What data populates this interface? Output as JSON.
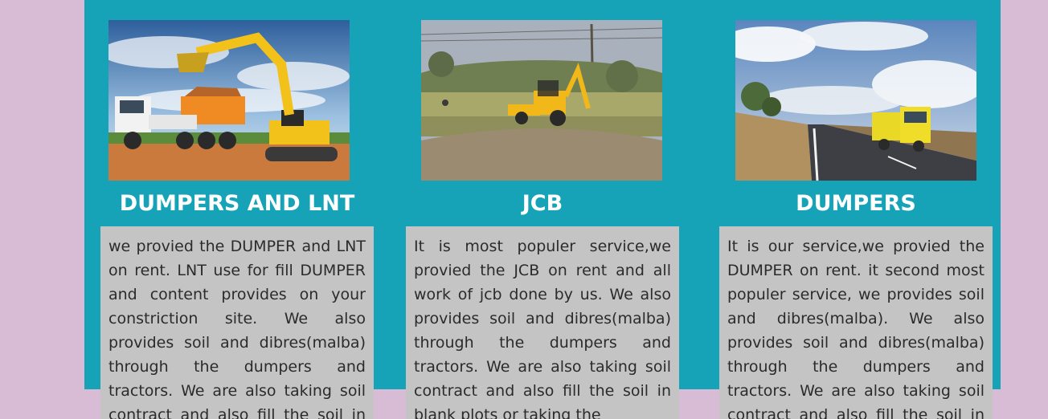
{
  "services": [
    {
      "title": "DUMPERS AND LNT",
      "image_icon": "dumper-truck-and-excavator-photo",
      "text": "we provied the DUMPER and LNT on rent. LNT use for fill DUMPER and content provides on your constriction site. We also provides soil and dibres(malba) through the dumpers and tractors. We are also taking soil contract and also fill the soil in blank plots or taking the"
    },
    {
      "title": "JCB",
      "image_icon": "jcb-backhoe-loader-photo",
      "text": "It is most populer service,we provied the JCB on rent and all work of jcb done by us. We also provides soil and dibres(malba) through the dumpers and tractors. We are also taking soil contract and also fill the soil in blank plots or taking the"
    },
    {
      "title": "DUMPERS",
      "image_icon": "dumper-truck-on-highway-photo",
      "text": "It is our service,we provied the DUMPER on rent. it second most populer service, we provides soil and dibres(malba). We also provides soil and dibres(malba) through the dumpers and tractors. We are also taking soil contract and also fill the soil in blank plots or taking the"
    }
  ],
  "colors": {
    "page_background": "#d8bcd6",
    "panel_background": "#16a3b7",
    "card_background": "#c4c4c4",
    "title_color": "#ffffff"
  }
}
